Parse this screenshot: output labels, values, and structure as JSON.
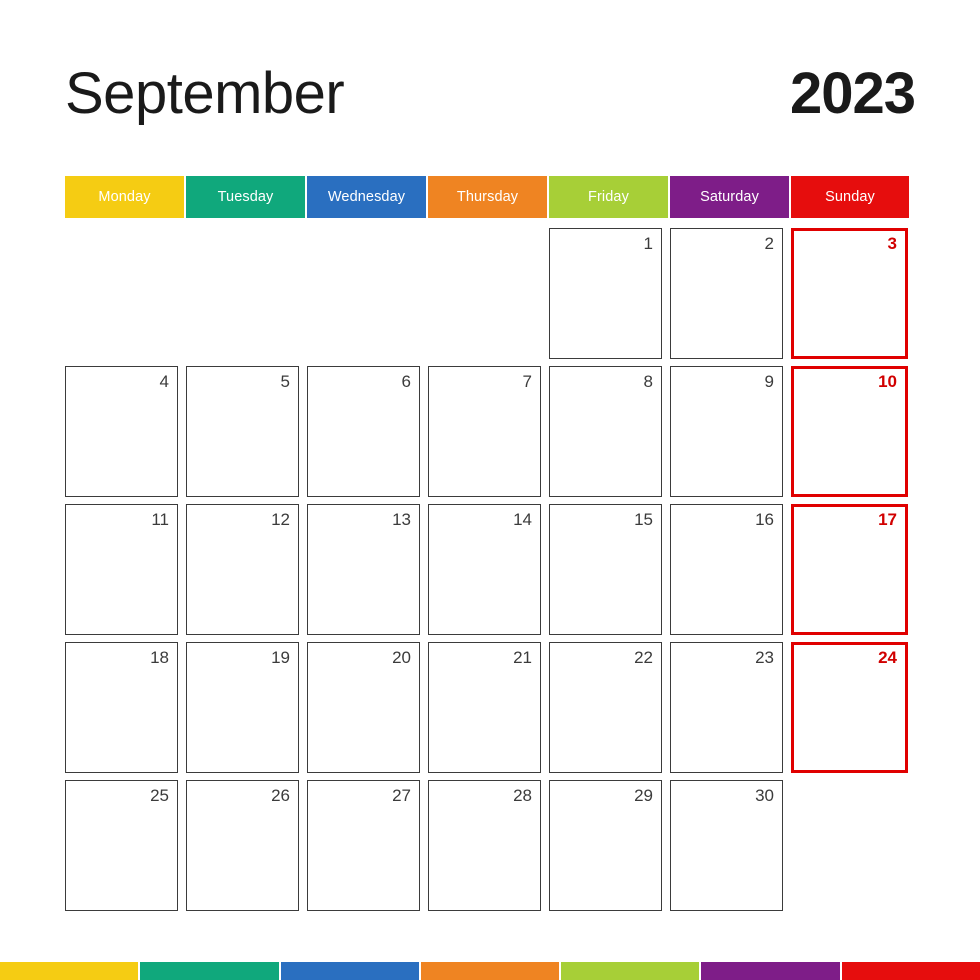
{
  "title": {
    "month": "September",
    "year": "2023"
  },
  "weekdays": [
    {
      "label": "Monday",
      "color": "#f5cc13"
    },
    {
      "label": "Tuesday",
      "color": "#10a87c"
    },
    {
      "label": "Wednesday",
      "color": "#2a6fc0"
    },
    {
      "label": "Thursday",
      "color": "#ef8422"
    },
    {
      "label": "Friday",
      "color": "#a7cf37"
    },
    {
      "label": "Saturday",
      "color": "#7e1d88"
    },
    {
      "label": "Sunday",
      "color": "#e60d0d"
    }
  ],
  "colors": {
    "cell_border": "#3b3b3b",
    "sunday_border": "#e00000",
    "sunday_number": "#d10000",
    "number": "#3b3b3b",
    "title": "#1a1a1a",
    "header_text": "#ffffff",
    "background": "#ffffff"
  },
  "weeks": [
    {
      "days": [
        {
          "number": "",
          "type": "empty"
        },
        {
          "number": "",
          "type": "empty"
        },
        {
          "number": "",
          "type": "empty"
        },
        {
          "number": "",
          "type": "empty"
        },
        {
          "number": "1",
          "type": "weekday"
        },
        {
          "number": "2",
          "type": "weekday"
        },
        {
          "number": "3",
          "type": "sunday"
        }
      ]
    },
    {
      "days": [
        {
          "number": "4",
          "type": "weekday"
        },
        {
          "number": "5",
          "type": "weekday"
        },
        {
          "number": "6",
          "type": "weekday"
        },
        {
          "number": "7",
          "type": "weekday"
        },
        {
          "number": "8",
          "type": "weekday"
        },
        {
          "number": "9",
          "type": "weekday"
        },
        {
          "number": "10",
          "type": "sunday"
        }
      ]
    },
    {
      "days": [
        {
          "number": "11",
          "type": "weekday"
        },
        {
          "number": "12",
          "type": "weekday"
        },
        {
          "number": "13",
          "type": "weekday"
        },
        {
          "number": "14",
          "type": "weekday"
        },
        {
          "number": "15",
          "type": "weekday"
        },
        {
          "number": "16",
          "type": "weekday"
        },
        {
          "number": "17",
          "type": "sunday"
        }
      ]
    },
    {
      "days": [
        {
          "number": "18",
          "type": "weekday"
        },
        {
          "number": "19",
          "type": "weekday"
        },
        {
          "number": "20",
          "type": "weekday"
        },
        {
          "number": "21",
          "type": "weekday"
        },
        {
          "number": "22",
          "type": "weekday"
        },
        {
          "number": "23",
          "type": "weekday"
        },
        {
          "number": "24",
          "type": "sunday"
        }
      ]
    },
    {
      "days": [
        {
          "number": "25",
          "type": "weekday"
        },
        {
          "number": "26",
          "type": "weekday"
        },
        {
          "number": "27",
          "type": "weekday"
        },
        {
          "number": "28",
          "type": "weekday"
        },
        {
          "number": "29",
          "type": "weekday"
        },
        {
          "number": "30",
          "type": "weekday"
        },
        {
          "number": "",
          "type": "empty"
        }
      ]
    }
  ],
  "bottom_strip": {
    "colors": [
      "#f5cc13",
      "#10a87c",
      "#2a6fc0",
      "#ef8422",
      "#a7cf37",
      "#7e1d88",
      "#e60d0d"
    ]
  }
}
